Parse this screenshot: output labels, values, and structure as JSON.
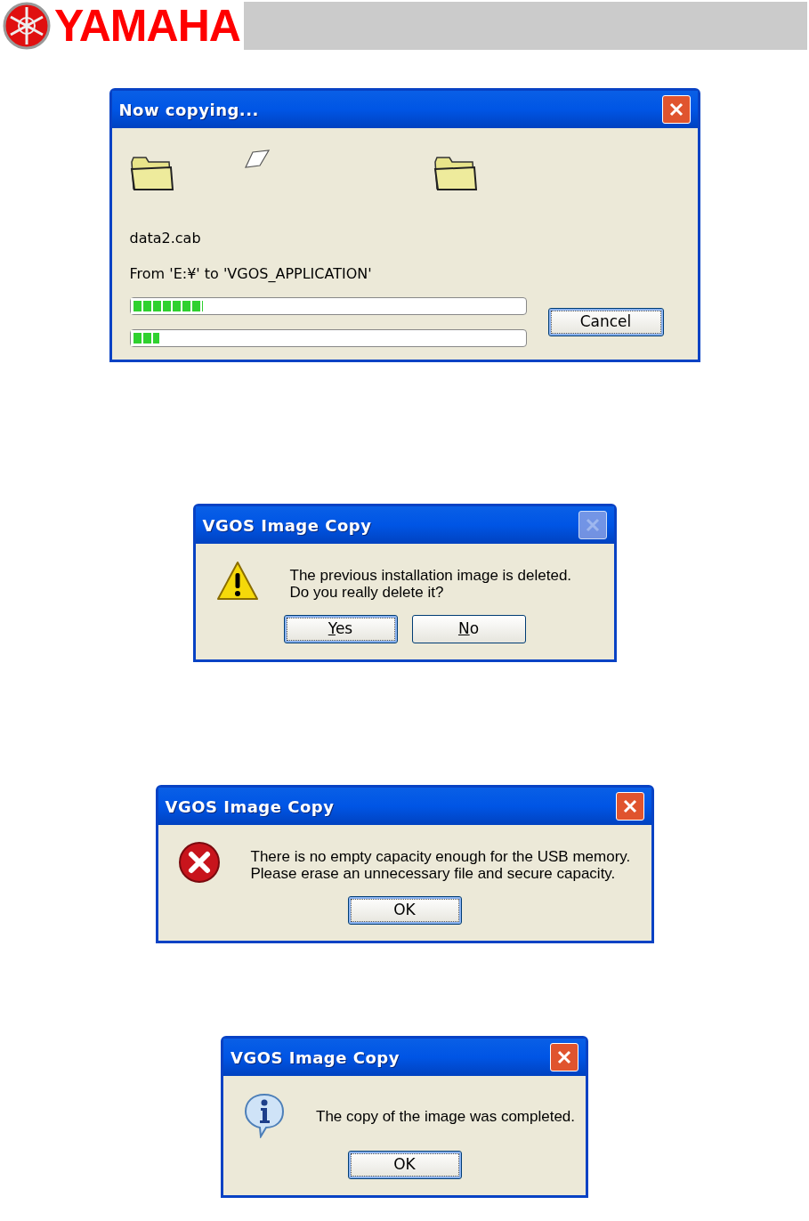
{
  "header": {
    "logo_text": "YAMAHA"
  },
  "dialogs": [
    {
      "kind": "progress",
      "title": "Now copying...",
      "close_disabled": false,
      "file": "data2.cab",
      "path": "From 'E:¥' to 'VGOS_APPLICATION'",
      "progress": [
        {
          "level": 0.19
        },
        {
          "level": 0.08
        }
      ],
      "buttons": [
        {
          "label": "Cancel",
          "focused": true,
          "mnemonic": false
        }
      ]
    },
    {
      "kind": "warning",
      "title": "VGOS Image Copy",
      "close_disabled": true,
      "lines": [
        "The previous installation image is deleted.",
        "Do you really delete it?"
      ],
      "buttons": [
        {
          "label": "Yes",
          "focused": true,
          "mnemonic": true
        },
        {
          "label": "No",
          "focused": false,
          "mnemonic": true
        }
      ]
    },
    {
      "kind": "error",
      "title": "VGOS Image Copy",
      "close_disabled": false,
      "lines": [
        "There is no empty capacity enough for the USB memory.",
        "Please erase an unnecessary file and secure capacity."
      ],
      "buttons": [
        {
          "label": "OK",
          "focused": true,
          "mnemonic": false
        }
      ]
    },
    {
      "kind": "info",
      "title": "VGOS Image Copy",
      "close_disabled": false,
      "lines": [
        "The copy of the image was completed."
      ],
      "buttons": [
        {
          "label": "OK",
          "focused": true,
          "mnemonic": false
        }
      ]
    }
  ]
}
